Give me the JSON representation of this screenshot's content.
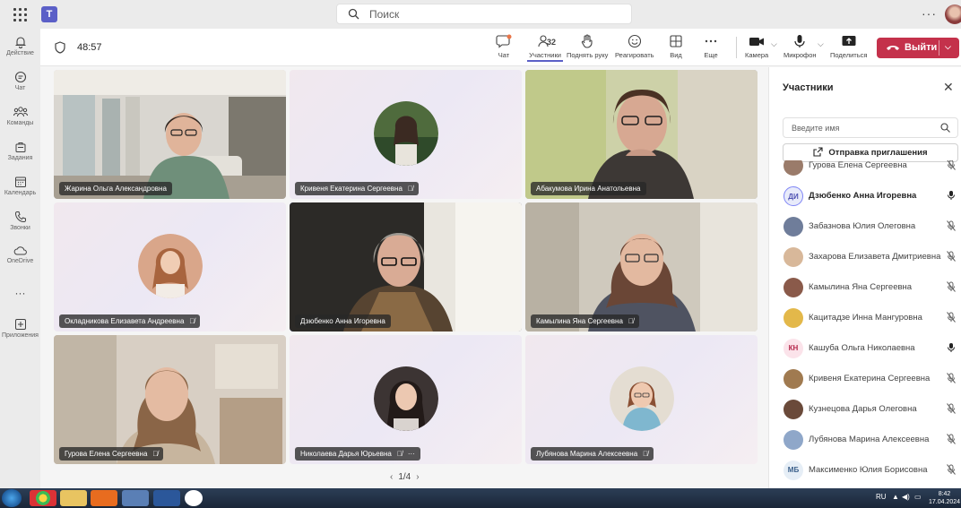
{
  "topbar": {
    "search_placeholder": "Поиск",
    "more_label": "···"
  },
  "rail": {
    "items": [
      {
        "label": "Действие",
        "icon": "bell-icon"
      },
      {
        "label": "Чат",
        "icon": "chat-icon"
      },
      {
        "label": "Команды",
        "icon": "teams-icon"
      },
      {
        "label": "Задания",
        "icon": "assignments-icon"
      },
      {
        "label": "Календарь",
        "icon": "calendar-icon"
      },
      {
        "label": "Звонки",
        "icon": "phone-icon"
      },
      {
        "label": "OneDrive",
        "icon": "cloud-icon"
      },
      {
        "label": "···",
        "icon": "more-icon"
      },
      {
        "label": "Приложения",
        "icon": "apps-icon"
      }
    ]
  },
  "meeting": {
    "timer": "48:57",
    "participants_count": "32",
    "toolbar": {
      "chat": "Чат",
      "participants": "Участники",
      "raise_hand": "Поднять руку",
      "react": "Реагировать",
      "view": "Вид",
      "more": "Еще",
      "camera": "Камера",
      "mic": "Микрофон",
      "share": "Поделиться"
    },
    "leave_label": "Выйти"
  },
  "tiles": [
    {
      "name": "Жарина Ольга Александровна",
      "mic": false,
      "active": false,
      "type": "video"
    },
    {
      "name": "Кривеня Екатерина Сергеевна",
      "mic": true,
      "active": false,
      "type": "avatar"
    },
    {
      "name": "Абакумова Ирина Анатольевна",
      "mic": false,
      "active": true,
      "type": "video"
    },
    {
      "name": "Окладникова Елизавета Андреевна",
      "mic": true,
      "active": false,
      "type": "avatar"
    },
    {
      "name": "Дзюбенко Анна Игоревна",
      "mic": false,
      "active": true,
      "type": "video"
    },
    {
      "name": "Камылина Яна Сергеевна",
      "mic": true,
      "active": false,
      "type": "video"
    },
    {
      "name": "Гурова Елена Сергеевна",
      "mic": true,
      "active": false,
      "type": "video"
    },
    {
      "name": "Николаева Дарья Юрьевна",
      "mic": true,
      "active": false,
      "type": "avatar"
    },
    {
      "name": "Лубянова Марина Алексеевна",
      "mic": true,
      "active": false,
      "type": "avatar"
    }
  ],
  "pager": "1/4",
  "panel": {
    "title": "Участники",
    "search_placeholder": "Введите имя",
    "invite_label": "Отправка приглашения",
    "participants": [
      {
        "name": "Гурова Елена Сергеевна",
        "initials": "",
        "muted": true,
        "speaking": false,
        "color": "#9a7b6a"
      },
      {
        "name": "Дзюбенко Анна Игоревна",
        "initials": "ДИ",
        "muted": false,
        "speaking": true,
        "color": "#e8ebfa"
      },
      {
        "name": "Забазнова Юлия Олеговна",
        "initials": "",
        "muted": true,
        "speaking": false,
        "color": "#6f7d9a"
      },
      {
        "name": "Захарова Елизавета Дмитриевна",
        "initials": "",
        "muted": true,
        "speaking": false,
        "color": "#d8b89a"
      },
      {
        "name": "Камылина Яна Сергеевна",
        "initials": "",
        "muted": true,
        "speaking": false,
        "color": "#8a5a4a"
      },
      {
        "name": "Кацитадзе Инна Мангуровна",
        "initials": "",
        "muted": true,
        "speaking": false,
        "color": "#e3b84a"
      },
      {
        "name": "Кашуба Ольга Николаевна",
        "initials": "КН",
        "muted": false,
        "speaking": false,
        "color": "#fbe3ea"
      },
      {
        "name": "Кривеня Екатерина Сергеевна",
        "initials": "",
        "muted": true,
        "speaking": false,
        "color": "#a07a50"
      },
      {
        "name": "Кузнецова Дарья Олеговна",
        "initials": "",
        "muted": true,
        "speaking": false,
        "color": "#6a4a3a"
      },
      {
        "name": "Лубянова Марина Алексеевна",
        "initials": "",
        "muted": true,
        "speaking": false,
        "color": "#8fa7c9"
      },
      {
        "name": "Максименко Юлия Борисовна",
        "initials": "МБ",
        "muted": true,
        "speaking": false,
        "color": "#e6eef6"
      }
    ]
  },
  "taskbar": {
    "lang": "RU",
    "time": "8:42",
    "date": "17.04.2024"
  },
  "colors": {
    "accent": "#5b5fc7",
    "leave": "#c4314b",
    "active_tile": "#7f85f5"
  }
}
